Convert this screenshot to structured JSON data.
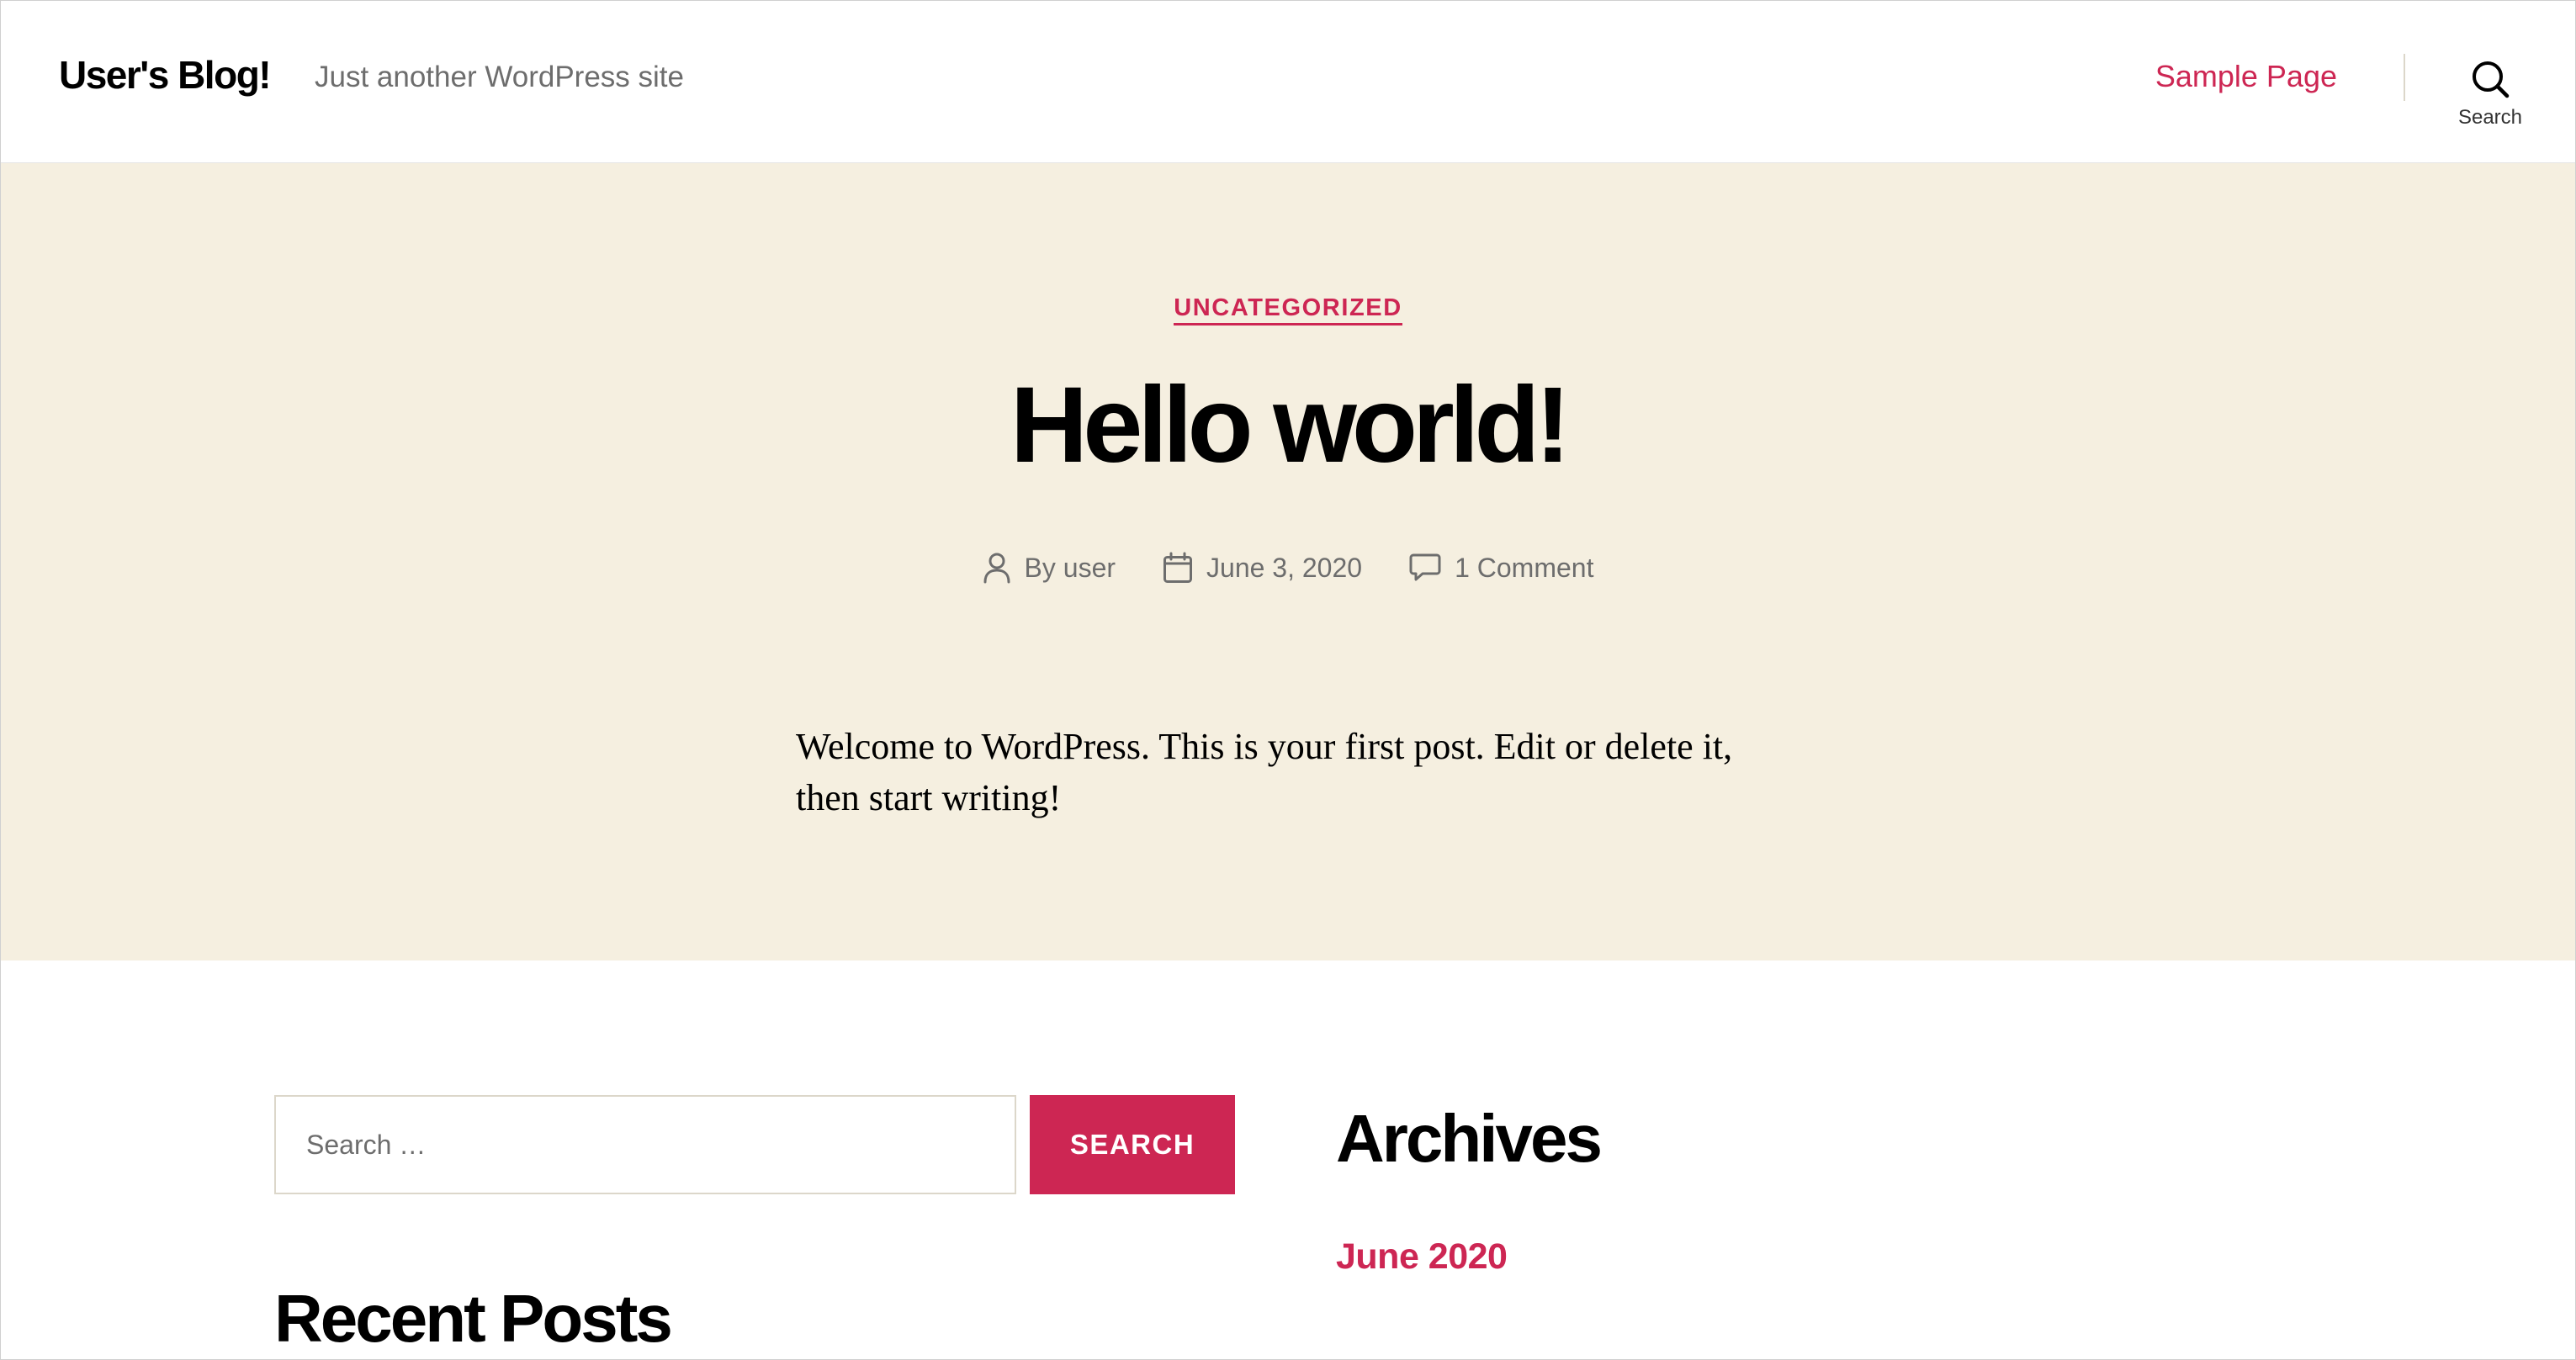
{
  "header": {
    "site_title": "User's Blog!",
    "site_description": "Just another WordPress site",
    "nav": [
      {
        "label": "Sample Page"
      }
    ],
    "search_toggle_label": "Search",
    "search_icon": "search-icon"
  },
  "post": {
    "category": "UNCATEGORIZED",
    "title": "Hello world!",
    "meta": {
      "author": "By user",
      "author_icon": "user-icon",
      "date": "June 3, 2020",
      "date_icon": "calendar-icon",
      "comments": "1 Comment",
      "comments_icon": "comment-icon"
    },
    "content": "Welcome to WordPress. This is your first post. Edit or delete it, then start writing!"
  },
  "widgets": {
    "search": {
      "placeholder": "Search …",
      "button_label": "SEARCH"
    },
    "archives": {
      "heading": "Archives",
      "items": [
        {
          "label": "June 2020"
        }
      ]
    },
    "recent_posts": {
      "heading": "Recent Posts"
    }
  },
  "colors": {
    "accent": "#cd2653",
    "hero_background": "#f5efe0",
    "secondary_text": "#6d6d6d"
  }
}
